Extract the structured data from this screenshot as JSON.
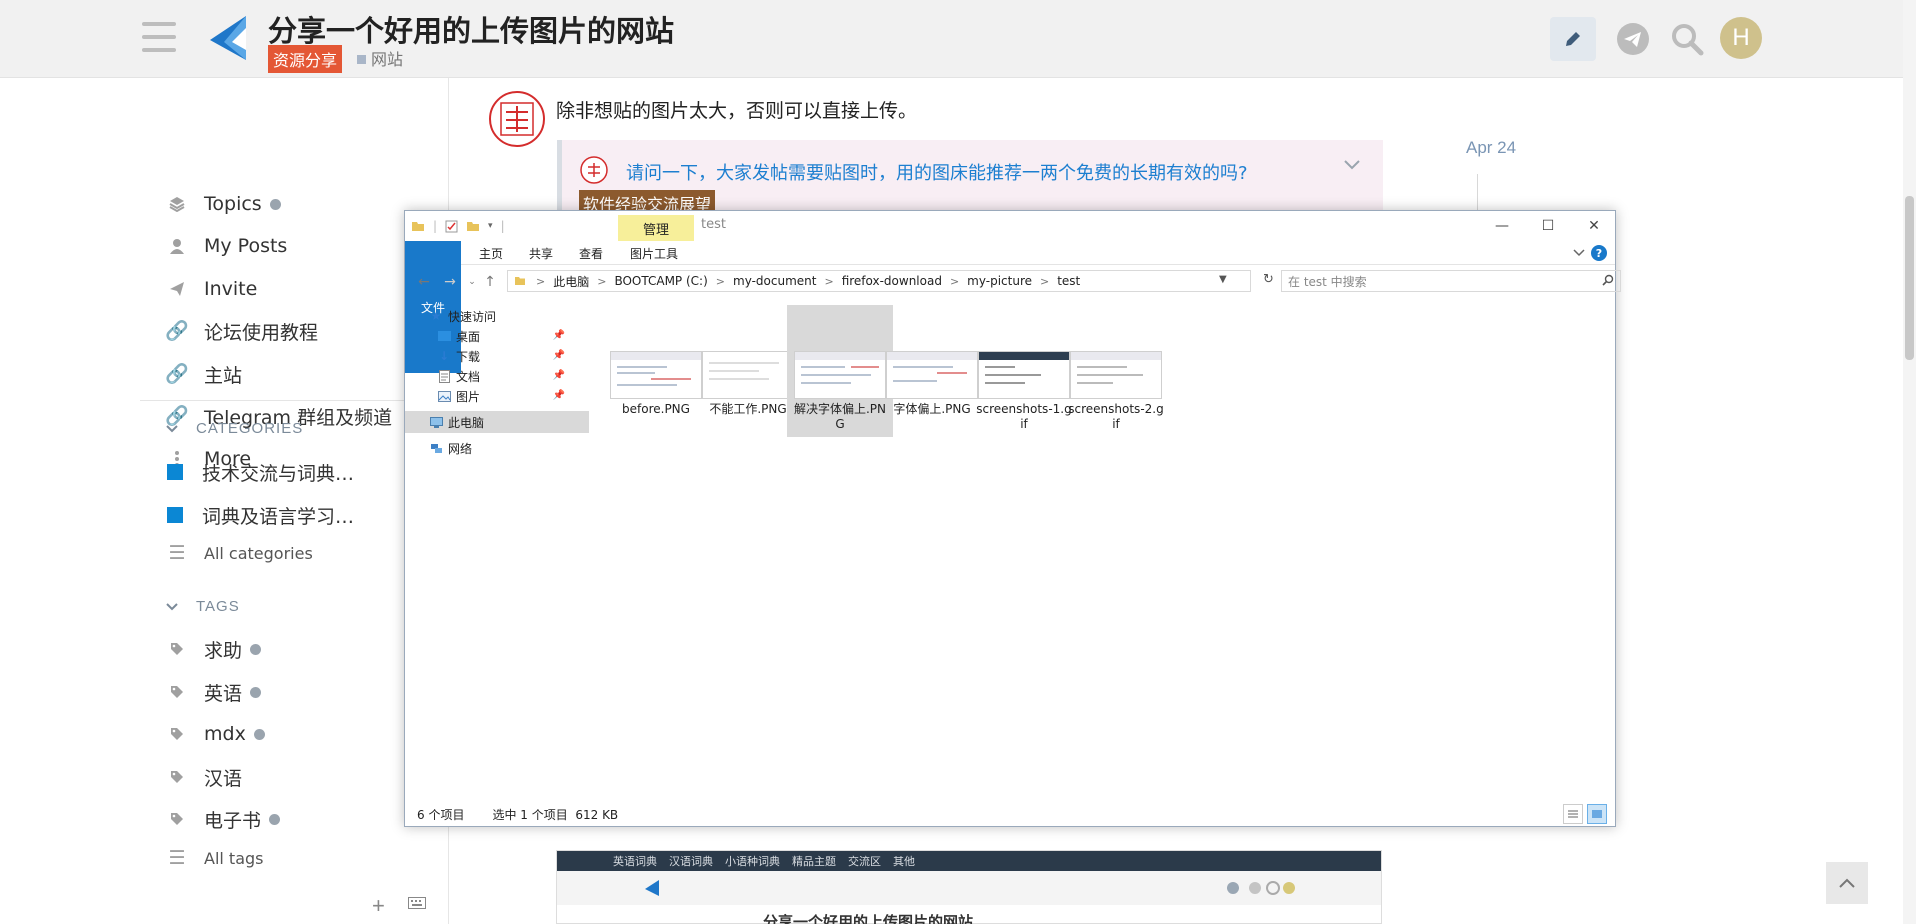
{
  "header": {
    "title": "分享一个好用的上传图片的网站",
    "category": "资源分享",
    "tag": "网站",
    "avatar_letter": "H"
  },
  "sidebar": {
    "items": [
      {
        "label": "Topics",
        "icon": "layers-icon",
        "dot": true
      },
      {
        "label": "My Posts",
        "icon": "user-icon",
        "dot": false
      },
      {
        "label": "Invite",
        "icon": "paper-plane-icon",
        "dot": false
      },
      {
        "label": "论坛使用教程",
        "icon": "link-icon",
        "dot": false
      },
      {
        "label": "主站",
        "icon": "link-icon",
        "dot": false
      },
      {
        "label": "Telegram 群组及频道",
        "icon": "link-icon",
        "dot": false
      },
      {
        "label": "More",
        "icon": "more-vertical-icon",
        "dot": false
      }
    ],
    "categories_heading": "CATEGORIES",
    "categories": [
      {
        "label": "技术交流与词典…",
        "color": "#0B87D4"
      },
      {
        "label": "词典及语言学习…",
        "color": "#0B87D4"
      }
    ],
    "all_categories": "All categories",
    "tags_heading": "TAGS",
    "tags": [
      {
        "label": "求助",
        "dot": true
      },
      {
        "label": "英语",
        "dot": true
      },
      {
        "label": "mdx",
        "dot": true
      },
      {
        "label": "汉语",
        "dot": false
      },
      {
        "label": "电子书",
        "dot": true
      }
    ],
    "all_tags": "All tags"
  },
  "post": {
    "text": "除非想贴的图片太大，否则可以直接上传。",
    "date": "Apr 24",
    "quote_link": "请问一下，大家发帖需要贴图时，用的图床能推荐一两个免费的长期有效的吗?",
    "quote_category": "软件经验交流展望",
    "preview_nav": [
      "英语词典",
      "汉语词典",
      "小语种词典",
      "精品主题",
      "交流区",
      "其他"
    ],
    "preview_title": "分享一个好用的上传图片的网站"
  },
  "explorer": {
    "window_title": "test",
    "context_tab": "管理",
    "ribbon_tabs": [
      "文件",
      "主页",
      "共享",
      "查看",
      "图片工具"
    ],
    "path": [
      "此电脑",
      "BOOTCAMP (C:)",
      "my-document",
      "firefox-download",
      "my-picture",
      "test"
    ],
    "search_placeholder": "在 test 中搜索",
    "nav": {
      "quick_access": "快速访问",
      "desktop": "桌面",
      "downloads": "下载",
      "documents": "文档",
      "pictures": "图片",
      "this_pc": "此电脑",
      "network": "网络"
    },
    "files": [
      {
        "name": "before.PNG",
        "selected": false
      },
      {
        "name": "不能工作.PNG",
        "selected": false
      },
      {
        "name": "解决字体偏上.PNG",
        "selected": true
      },
      {
        "name": "字体偏上.PNG",
        "selected": false
      },
      {
        "name": "screenshots-1.gif",
        "selected": false
      },
      {
        "name": "screenshots-2.gif",
        "selected": false
      }
    ],
    "status_count": "6 个项目",
    "status_selected": "选中 1 个项目  612 KB"
  },
  "colors": {
    "category_badge": "#E45735",
    "quote_category_badge": "#8C5A2E",
    "explorer_accent": "#1979CA",
    "link": "#1D7FD0"
  }
}
